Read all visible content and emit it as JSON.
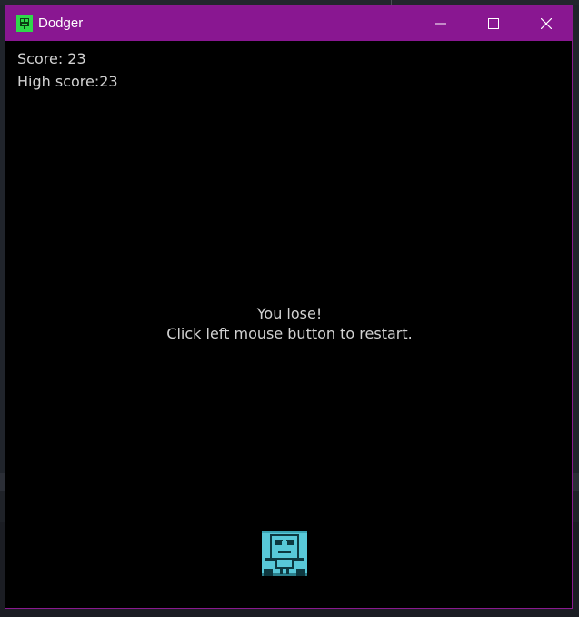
{
  "window": {
    "title": "Dodger",
    "controls": {
      "minimize_icon": "minimize-icon",
      "maximize_icon": "maximize-icon",
      "close_icon": "close-icon"
    },
    "titlebar_color": "#891791"
  },
  "hud": {
    "score_text": "Score: 23",
    "high_score_text": "High score:23"
  },
  "message": {
    "line1": "You lose!",
    "line2": "Click left mouse button to restart."
  },
  "player": {
    "icon": "player-face-icon",
    "color": "#58c8d8"
  }
}
